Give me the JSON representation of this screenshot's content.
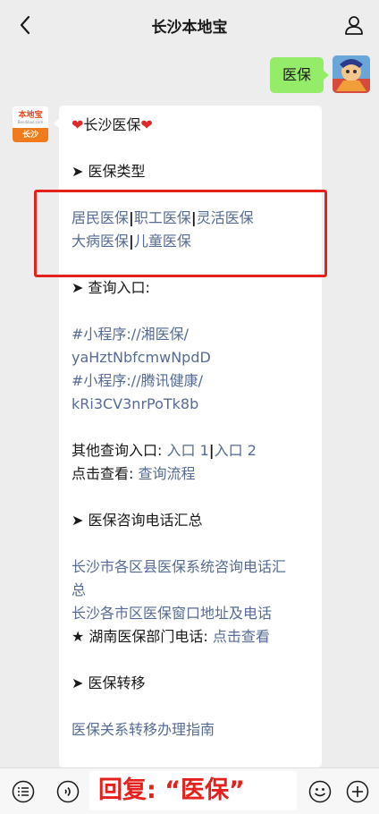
{
  "header": {
    "title": "长沙本地宝"
  },
  "outgoing": {
    "text": "医保"
  },
  "sender": {
    "logo_name": "本地宝",
    "logo_url": "Bendibao.com",
    "logo_city": "长沙"
  },
  "message": {
    "title": "长沙医保",
    "section1": "医保类型",
    "types_row1": [
      "居民医保",
      "职工医保",
      "灵活医保"
    ],
    "types_row2": [
      "大病医保",
      "儿童医保"
    ],
    "section2": "查询入口:",
    "mini1_label": "#小程序://湘医保/",
    "mini1_code": "yaHztNbfcmwNpdD",
    "mini2_label": "#小程序://腾讯健康/",
    "mini2_code": "kRi3CV3nrPoTk8b",
    "other_label": "其他查询入口: ",
    "other_link1": "入口 1",
    "other_link2": "入口 2",
    "click_label": "点击查看: ",
    "click_link": "查询流程",
    "section3": "医保咨询电话汇总",
    "phone_link1_a": "长沙市各区县医保系统咨询电话汇",
    "phone_link1_b": "总",
    "phone_link2": "长沙各市区医保窗口地址及电话",
    "hunan_label": "★ 湖南医保部门电话: ",
    "hunan_link": "点击查看",
    "section4": "医保转移",
    "transfer_link": "医保关系转移办理指南"
  },
  "input_bar": {
    "reply_hint": "回复:  “医保”"
  },
  "colors": {
    "link": "#576b95",
    "bubble_out": "#95ec69",
    "highlight": "#e5211e"
  }
}
